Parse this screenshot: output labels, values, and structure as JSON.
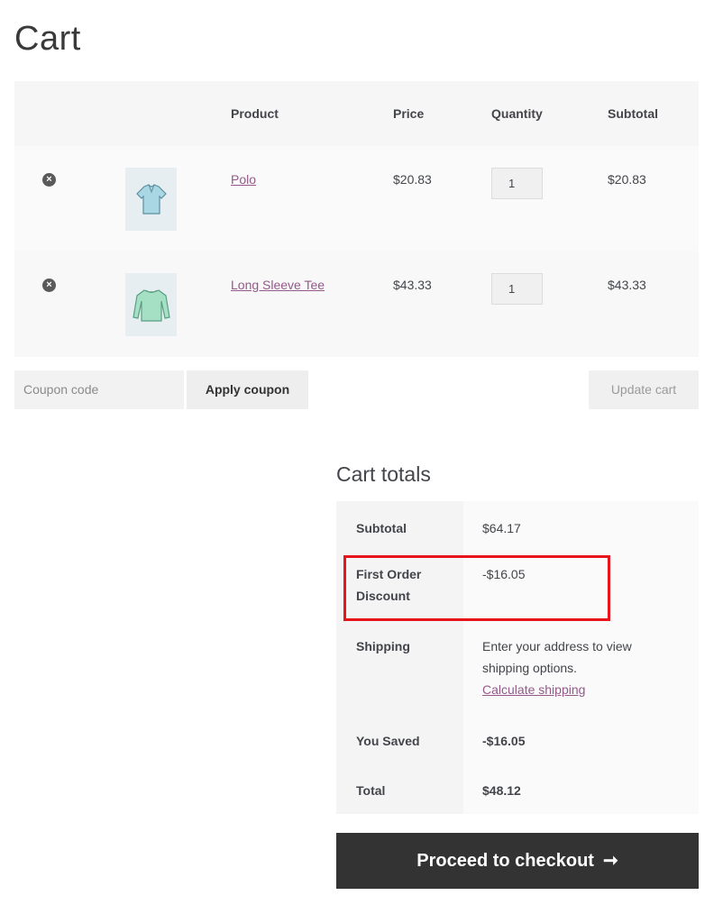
{
  "page": {
    "title": "Cart"
  },
  "cart_table": {
    "headers": {
      "product": "Product",
      "price": "Price",
      "quantity": "Quantity",
      "subtotal": "Subtotal"
    },
    "rows": [
      {
        "product": "Polo",
        "price": "$20.83",
        "quantity": "1",
        "subtotal": "$20.83",
        "image": "polo-shirt-icon"
      },
      {
        "product": "Long Sleeve Tee",
        "price": "$43.33",
        "quantity": "1",
        "subtotal": "$43.33",
        "image": "long-sleeve-tee-icon"
      }
    ]
  },
  "coupon": {
    "placeholder": "Coupon code",
    "apply_label": "Apply coupon"
  },
  "update_label": "Update cart",
  "totals": {
    "title": "Cart totals",
    "subtotal_label": "Subtotal",
    "subtotal_value": "$64.17",
    "discount_label": "First Order Discount",
    "discount_value": "-$16.05",
    "shipping_label": "Shipping",
    "shipping_text": "Enter your address to view shipping options.",
    "shipping_link": "Calculate shipping",
    "saved_label": "You Saved",
    "saved_value": "-$16.05",
    "total_label": "Total",
    "total_value": "$48.12"
  },
  "checkout": {
    "label": "Proceed to checkout",
    "icon": "arrow-right-icon"
  },
  "colors": {
    "link": "#96588a",
    "checkout_bg": "#333333",
    "highlight": "#e8141c"
  }
}
